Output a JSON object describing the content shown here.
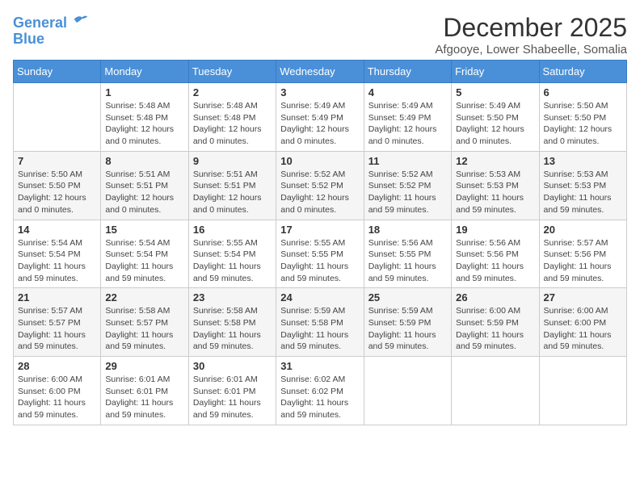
{
  "logo": {
    "part1": "General",
    "part2": "Blue"
  },
  "header": {
    "month": "December 2025",
    "location": "Afgooye, Lower Shabeelle, Somalia"
  },
  "days_of_week": [
    "Sunday",
    "Monday",
    "Tuesday",
    "Wednesday",
    "Thursday",
    "Friday",
    "Saturday"
  ],
  "weeks": [
    [
      {
        "day": "",
        "content": ""
      },
      {
        "day": "1",
        "content": "Sunrise: 5:48 AM\nSunset: 5:48 PM\nDaylight: 12 hours and 0 minutes."
      },
      {
        "day": "2",
        "content": "Sunrise: 5:48 AM\nSunset: 5:48 PM\nDaylight: 12 hours and 0 minutes."
      },
      {
        "day": "3",
        "content": "Sunrise: 5:49 AM\nSunset: 5:49 PM\nDaylight: 12 hours and 0 minutes."
      },
      {
        "day": "4",
        "content": "Sunrise: 5:49 AM\nSunset: 5:49 PM\nDaylight: 12 hours and 0 minutes."
      },
      {
        "day": "5",
        "content": "Sunrise: 5:49 AM\nSunset: 5:50 PM\nDaylight: 12 hours and 0 minutes."
      },
      {
        "day": "6",
        "content": "Sunrise: 5:50 AM\nSunset: 5:50 PM\nDaylight: 12 hours and 0 minutes."
      }
    ],
    [
      {
        "day": "7",
        "content": "Sunrise: 5:50 AM\nSunset: 5:50 PM\nDaylight: 12 hours and 0 minutes."
      },
      {
        "day": "8",
        "content": "Sunrise: 5:51 AM\nSunset: 5:51 PM\nDaylight: 12 hours and 0 minutes."
      },
      {
        "day": "9",
        "content": "Sunrise: 5:51 AM\nSunset: 5:51 PM\nDaylight: 12 hours and 0 minutes."
      },
      {
        "day": "10",
        "content": "Sunrise: 5:52 AM\nSunset: 5:52 PM\nDaylight: 12 hours and 0 minutes."
      },
      {
        "day": "11",
        "content": "Sunrise: 5:52 AM\nSunset: 5:52 PM\nDaylight: 11 hours and 59 minutes."
      },
      {
        "day": "12",
        "content": "Sunrise: 5:53 AM\nSunset: 5:53 PM\nDaylight: 11 hours and 59 minutes."
      },
      {
        "day": "13",
        "content": "Sunrise: 5:53 AM\nSunset: 5:53 PM\nDaylight: 11 hours and 59 minutes."
      }
    ],
    [
      {
        "day": "14",
        "content": "Sunrise: 5:54 AM\nSunset: 5:54 PM\nDaylight: 11 hours and 59 minutes."
      },
      {
        "day": "15",
        "content": "Sunrise: 5:54 AM\nSunset: 5:54 PM\nDaylight: 11 hours and 59 minutes."
      },
      {
        "day": "16",
        "content": "Sunrise: 5:55 AM\nSunset: 5:54 PM\nDaylight: 11 hours and 59 minutes."
      },
      {
        "day": "17",
        "content": "Sunrise: 5:55 AM\nSunset: 5:55 PM\nDaylight: 11 hours and 59 minutes."
      },
      {
        "day": "18",
        "content": "Sunrise: 5:56 AM\nSunset: 5:55 PM\nDaylight: 11 hours and 59 minutes."
      },
      {
        "day": "19",
        "content": "Sunrise: 5:56 AM\nSunset: 5:56 PM\nDaylight: 11 hours and 59 minutes."
      },
      {
        "day": "20",
        "content": "Sunrise: 5:57 AM\nSunset: 5:56 PM\nDaylight: 11 hours and 59 minutes."
      }
    ],
    [
      {
        "day": "21",
        "content": "Sunrise: 5:57 AM\nSunset: 5:57 PM\nDaylight: 11 hours and 59 minutes."
      },
      {
        "day": "22",
        "content": "Sunrise: 5:58 AM\nSunset: 5:57 PM\nDaylight: 11 hours and 59 minutes."
      },
      {
        "day": "23",
        "content": "Sunrise: 5:58 AM\nSunset: 5:58 PM\nDaylight: 11 hours and 59 minutes."
      },
      {
        "day": "24",
        "content": "Sunrise: 5:59 AM\nSunset: 5:58 PM\nDaylight: 11 hours and 59 minutes."
      },
      {
        "day": "25",
        "content": "Sunrise: 5:59 AM\nSunset: 5:59 PM\nDaylight: 11 hours and 59 minutes."
      },
      {
        "day": "26",
        "content": "Sunrise: 6:00 AM\nSunset: 5:59 PM\nDaylight: 11 hours and 59 minutes."
      },
      {
        "day": "27",
        "content": "Sunrise: 6:00 AM\nSunset: 6:00 PM\nDaylight: 11 hours and 59 minutes."
      }
    ],
    [
      {
        "day": "28",
        "content": "Sunrise: 6:00 AM\nSunset: 6:00 PM\nDaylight: 11 hours and 59 minutes."
      },
      {
        "day": "29",
        "content": "Sunrise: 6:01 AM\nSunset: 6:01 PM\nDaylight: 11 hours and 59 minutes."
      },
      {
        "day": "30",
        "content": "Sunrise: 6:01 AM\nSunset: 6:01 PM\nDaylight: 11 hours and 59 minutes."
      },
      {
        "day": "31",
        "content": "Sunrise: 6:02 AM\nSunset: 6:02 PM\nDaylight: 11 hours and 59 minutes."
      },
      {
        "day": "",
        "content": ""
      },
      {
        "day": "",
        "content": ""
      },
      {
        "day": "",
        "content": ""
      }
    ]
  ]
}
